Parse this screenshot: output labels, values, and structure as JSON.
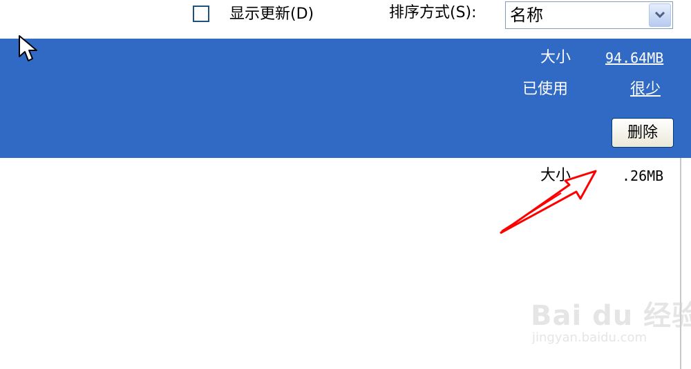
{
  "toolbar": {
    "show_updates_label": "显示更新(D)",
    "show_updates_checked": false,
    "sort_label": "排序方式(S):",
    "sort_value": "名称"
  },
  "selected_item": {
    "size_label": "大小",
    "size_value": "94.64MB",
    "used_label": "已使用",
    "used_value": "很少",
    "delete_label": "删除"
  },
  "next_item": {
    "size_label": "大小",
    "size_value": ".26MB"
  },
  "watermark": {
    "brand": "Bai du 经验",
    "url": "jingyan.baidu.com"
  },
  "colors": {
    "selection": "#316ac5",
    "annotation_arrow": "#ff0000"
  }
}
